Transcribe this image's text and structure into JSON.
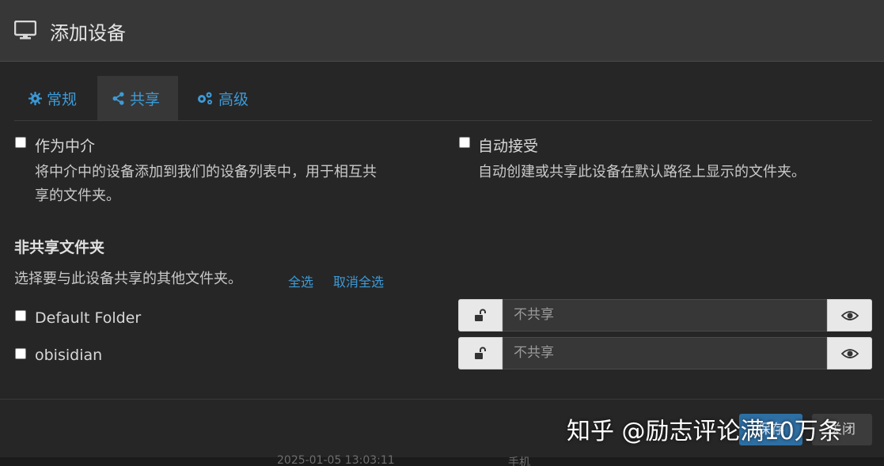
{
  "dialog": {
    "title": "添加设备",
    "icon": "desktop-icon"
  },
  "tabs": [
    {
      "label": "常规",
      "icon": "gear-icon",
      "active": false
    },
    {
      "label": "共享",
      "icon": "share-icon",
      "active": true
    },
    {
      "label": "高级",
      "icon": "gears-icon",
      "active": false
    }
  ],
  "introducer": {
    "label": "作为中介",
    "checked": false,
    "help_line1": "将中介中的设备添加到我们的设备列表中，用于相互共",
    "help_line2": "享的文件夹。"
  },
  "auto_accept": {
    "label": "自动接受",
    "checked": false,
    "help": "自动创建或共享此设备在默认路径上显示的文件夹。"
  },
  "unshared": {
    "title": "非共享文件夹",
    "description": "选择要与此设备共享的其他文件夹。",
    "select_all": "全选",
    "deselect_all": "取消全选"
  },
  "folders": [
    {
      "name": "Default Folder",
      "checked": false,
      "share_placeholder": "不共享"
    },
    {
      "name": "obisidian",
      "checked": false,
      "share_placeholder": "不共享"
    }
  ],
  "footer": {
    "save_label": "保存",
    "close_label": "关闭"
  },
  "background": {
    "partial_timestamp": "2025-01-05 13:03:11",
    "partial_text": "手机"
  },
  "watermark": "知乎 @励志评论满10万条",
  "colors": {
    "accent": "#3d9ad6",
    "header_bg": "#373737",
    "body_bg": "#262626"
  }
}
